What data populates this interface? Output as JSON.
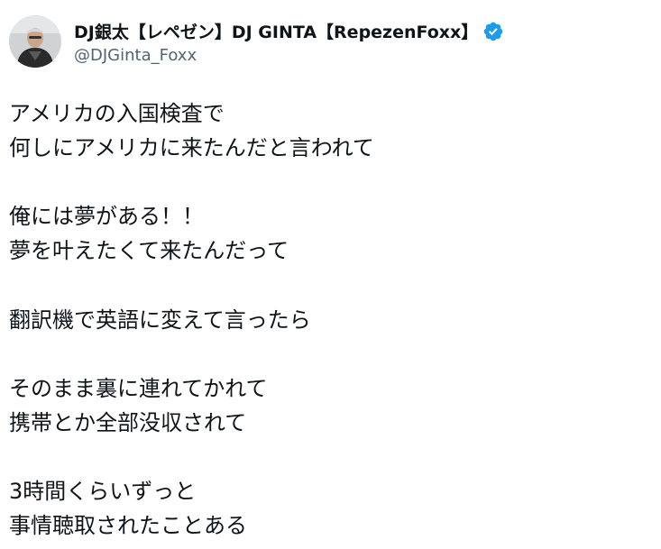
{
  "tweet": {
    "author": {
      "display_name": "DJ銀太【レペゼン】DJ GINTA【RepezenFoxx】",
      "handle": "@DJGinta_Foxx",
      "verified_icon": "verified-badge-icon"
    },
    "colors": {
      "text": "#0f1419",
      "secondary": "#536471",
      "verified": "#1d9bf0"
    },
    "paragraphs": [
      [
        "アメリカの入国検査で",
        "何しにアメリカに来たんだと言われて"
      ],
      [
        "俺には夢がある！！",
        "夢を叶えたくて来たんだって"
      ],
      [
        "翻訳機で英語に変えて言ったら"
      ],
      [
        "そのまま裏に連れてかれて",
        "携帯とか全部没収されて"
      ],
      [
        "3時間くらいずっと",
        "事情聴取されたことある"
      ]
    ]
  }
}
